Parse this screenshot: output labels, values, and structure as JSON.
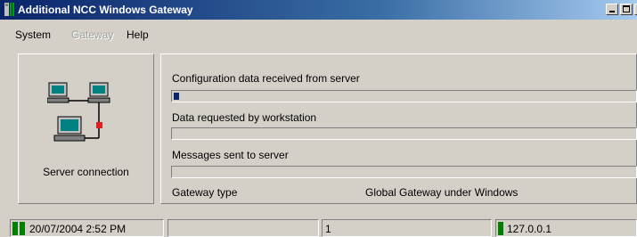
{
  "window": {
    "title": "Additional NCC Windows Gateway"
  },
  "menu": {
    "items": [
      {
        "label": "System",
        "enabled": true
      },
      {
        "label": "Gateway",
        "enabled": false
      },
      {
        "label": "Help",
        "enabled": true
      }
    ]
  },
  "left_panel": {
    "icon": "network-computers-icon",
    "label": "Server connection"
  },
  "progress": [
    {
      "label": "Configuration data received from server",
      "fraction": 0.012
    },
    {
      "label": "Data requested by workstation",
      "fraction": 0
    },
    {
      "label": "Messages sent to server",
      "fraction": 0
    }
  ],
  "info": {
    "gateway_type_label": "Gateway type",
    "gateway_type_value": "Global Gateway under Windows"
  },
  "statusbar": {
    "datetime": "20/07/2004 2:52 PM",
    "field2": "",
    "count": "1",
    "address": "127.0.0.1"
  },
  "colors": {
    "titlebar_start": "#0a246a",
    "titlebar_end": "#a6caf0",
    "progress_fill": "#0a246a",
    "status_led": "#008000",
    "connection_link": "#e02020"
  }
}
